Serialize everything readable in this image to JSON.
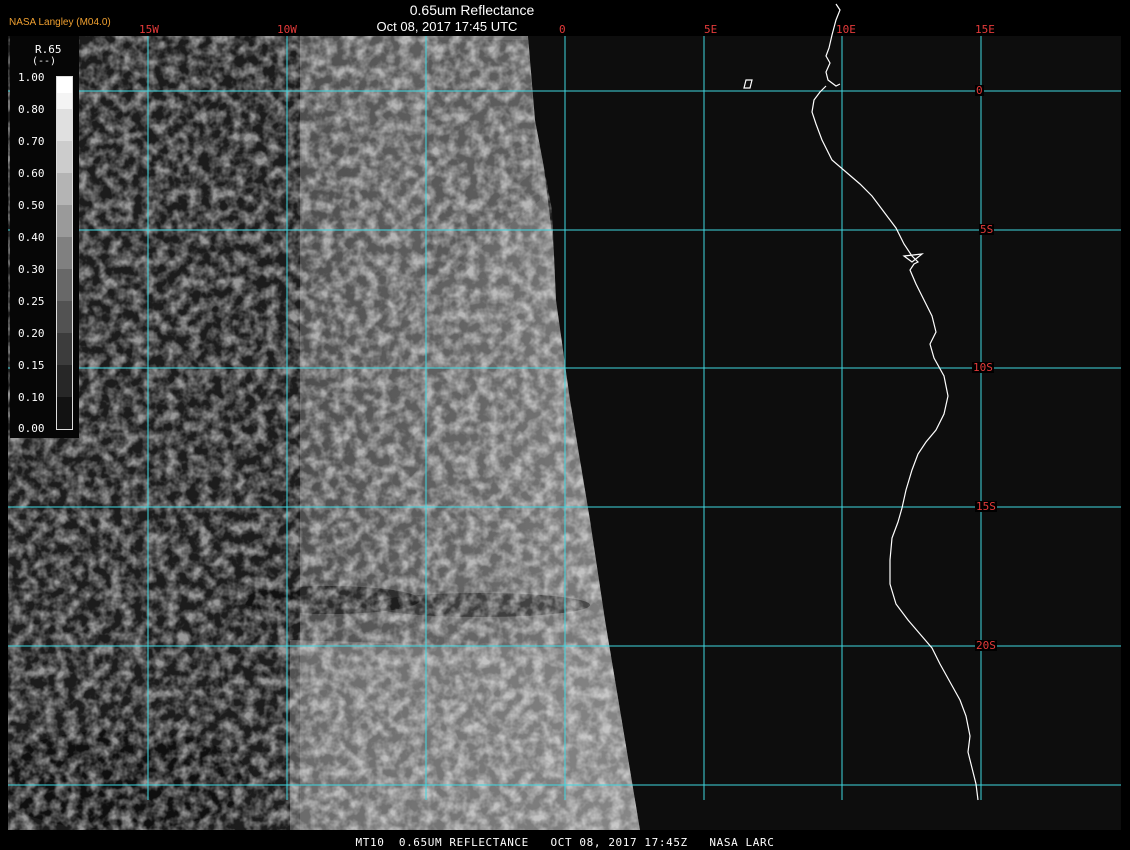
{
  "header": {
    "credit": "NASA Langley (M04.0)",
    "title": "0.65um Reflectance",
    "datetime": "Oct 08, 2017 17:45 UTC"
  },
  "grid": {
    "longitude_labels": [
      "15W",
      "10W",
      "0",
      "5E",
      "10E",
      "15E"
    ],
    "latitude_labels": [
      "0",
      "5S",
      "10S",
      "15S",
      "20S"
    ],
    "line_color": "#3fd7e0",
    "label_color": "#e53a3a"
  },
  "colorbar": {
    "title": "R.65",
    "units": "(--)",
    "ticks": [
      "1.00",
      "0.80",
      "0.70",
      "0.60",
      "0.50",
      "0.40",
      "0.30",
      "0.25",
      "0.20",
      "0.15",
      "0.10",
      "0.00"
    ]
  },
  "colors": {
    "coastline": "#ffffff",
    "credit": "#f0a030",
    "background": "#0d0d0d"
  },
  "footer": {
    "text": "MT10  0.65UM REFLECTANCE   OCT 08, 2017 17:45Z   NASA LARC"
  }
}
